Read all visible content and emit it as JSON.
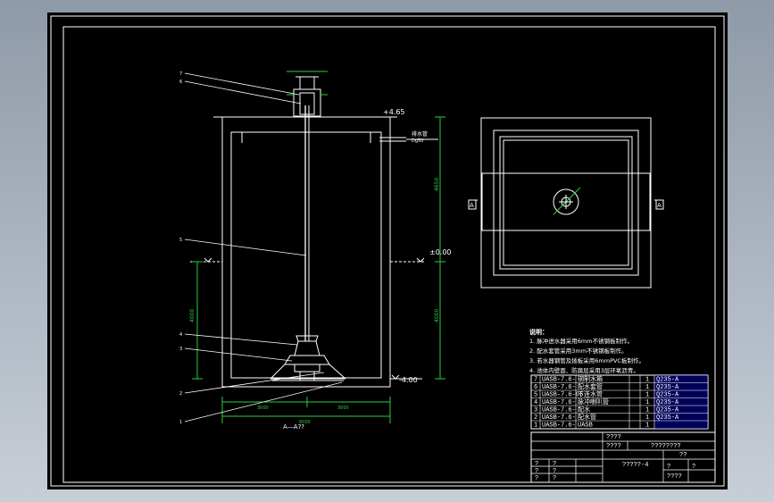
{
  "elevations": {
    "top": "+4.65",
    "zero": "±0.00",
    "bottom": "-4.00"
  },
  "outlet_note": {
    "line1": "排水管",
    "line2": "Dg50"
  },
  "section_title": "A—A??",
  "plan_markers": {
    "left": "A",
    "right": "A"
  },
  "balloons": [
    "7",
    "6",
    "5",
    "4",
    "3",
    "2",
    "1"
  ],
  "dimensions": {
    "bottom_left": "3000",
    "bottom_total": "6000",
    "bottom_right": "3000",
    "right_upper": "4650",
    "right_lower": "4000",
    "left_lower": "4000"
  },
  "notes": {
    "title": "说明：",
    "items": [
      "1. 脉冲进水器采用6mm不锈钢板制作。",
      "2. 配水套管采用3mm不锈钢板制作。",
      "3. 若水器钢管及插板采用6mmPVC板制作。",
      "4. 池体内壁面、防腐层采用3层环氧沥青。"
    ]
  },
  "parts": [
    {
      "no": "7",
      "code": "UASB-7.6-",
      "name": "钢制水箱",
      "qty": "1",
      "material": "Q235-A"
    },
    {
      "no": "6",
      "code": "UASB-7.6-",
      "name": "配水套管",
      "qty": "1",
      "material": "Q235-A"
    },
    {
      "no": "5",
      "code": "UASB-7.6-06",
      "name": "下连水管",
      "qty": "1",
      "material": "Q235-A"
    },
    {
      "no": "4",
      "code": "UASB-7.6-",
      "name": "脉冲喇叭管",
      "qty": "1",
      "material": "Q235-A"
    },
    {
      "no": "3",
      "code": "UASB-7.6-",
      "name": "配水",
      "qty": "1",
      "material": "Q235-A"
    },
    {
      "no": "2",
      "code": "UASB-7.6-",
      "name": "配水管",
      "qty": "1",
      "material": "Q235-A"
    },
    {
      "no": "1",
      "code": "UASB-7.6-",
      "name": "UASB",
      "qty": "1",
      "material": ""
    }
  ],
  "titleblock": {
    "r1": "????",
    "r2a": "????",
    "r2b": "????????",
    "drawing_no": "?????-4",
    "r3": "??",
    "q": "?",
    "r4": "????"
  }
}
